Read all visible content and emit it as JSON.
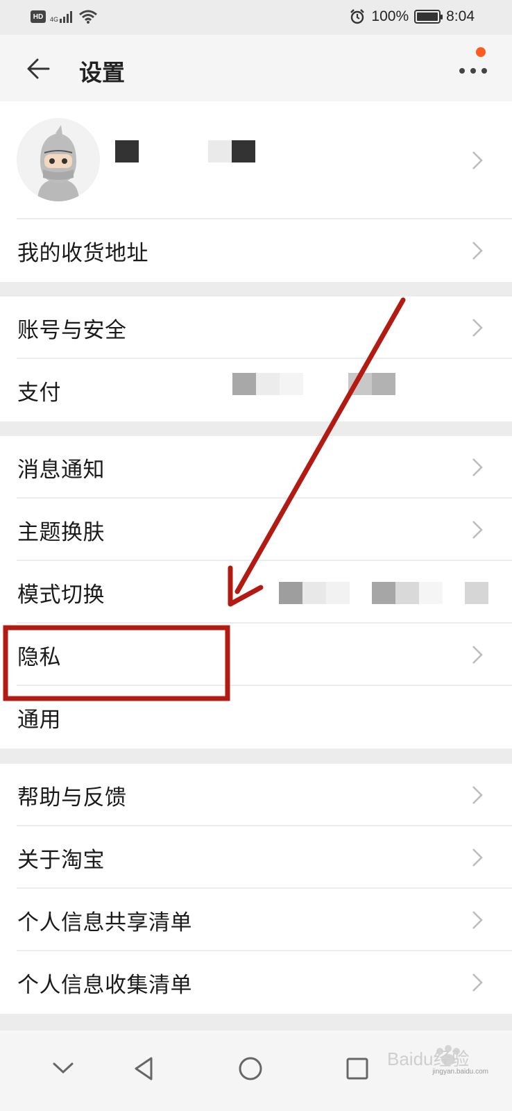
{
  "status_bar": {
    "hd": "HD",
    "network": "4G",
    "battery_text": "100%",
    "battery_level": 1.0,
    "time": "8:04"
  },
  "header": {
    "title": "设置"
  },
  "groups": [
    [
      {
        "label": "我的收货地址"
      }
    ],
    [
      {
        "label": "账号与安全"
      },
      {
        "label": "支付"
      }
    ],
    [
      {
        "label": "消息通知"
      },
      {
        "label": "主题换肤"
      },
      {
        "label": "模式切换"
      },
      {
        "label": "隐私"
      },
      {
        "label": "通用"
      }
    ],
    [
      {
        "label": "帮助与反馈"
      },
      {
        "label": "关于淘宝"
      },
      {
        "label": "个人信息共享清单"
      },
      {
        "label": "个人信息收集清单"
      }
    ]
  ],
  "colors": {
    "annotation_red": "#b31a12",
    "notify_dot": "#ff5a1f"
  },
  "watermark": {
    "brand": "Baidu经验",
    "url": "jingyan.baidu.com"
  }
}
